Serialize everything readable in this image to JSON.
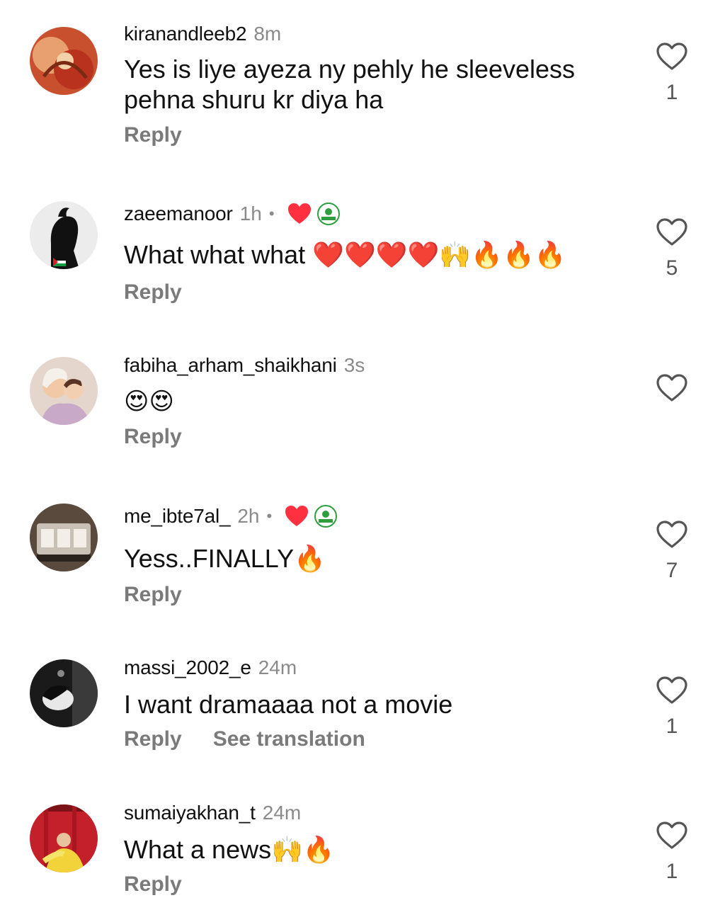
{
  "comments": [
    {
      "username": "kiranandleeb2",
      "time": "8m",
      "text_lines": [
        "Yes is liye ayeza ny pehly he sleeveless",
        "pehna shuru kr diya ha"
      ],
      "reply_label": "Reply",
      "like_count": "1"
    },
    {
      "username": "zaeemanoor",
      "time": "1h",
      "separator": "•",
      "creator_liked": true,
      "text": "What what what ❤️❤️❤️❤️🙌🔥🔥🔥",
      "reply_label": "Reply",
      "like_count": "5"
    },
    {
      "username": "fabiha_arham_shaikhani",
      "time": "3s",
      "text": "😍😍",
      "reply_label": "Reply",
      "like_count": ""
    },
    {
      "username": "me_ibte7al_",
      "time": "2h",
      "separator": "•",
      "creator_liked": true,
      "text": "Yess..FINALLY🔥",
      "reply_label": "Reply",
      "like_count": "7"
    },
    {
      "username": "massi_2002_e",
      "time": "24m",
      "text": "I want dramaaaa not a movie",
      "reply_label": "Reply",
      "see_translation_label": "See translation",
      "like_count": "1"
    },
    {
      "username": "sumaiyakhan_t",
      "time": "24m",
      "text": "What a news🙌🔥",
      "reply_label": "Reply",
      "like_count": "1"
    }
  ],
  "colors": {
    "heart_red": "#ff3040",
    "secondary_text": "#8a8a8a",
    "reply_text": "#7a7a7a",
    "page_badge_green": "#2e9e3e"
  },
  "icons": {
    "like": "heart-outline-icon",
    "creator_like": "red-heart-icon",
    "page_badge": "cinema-page-badge"
  }
}
